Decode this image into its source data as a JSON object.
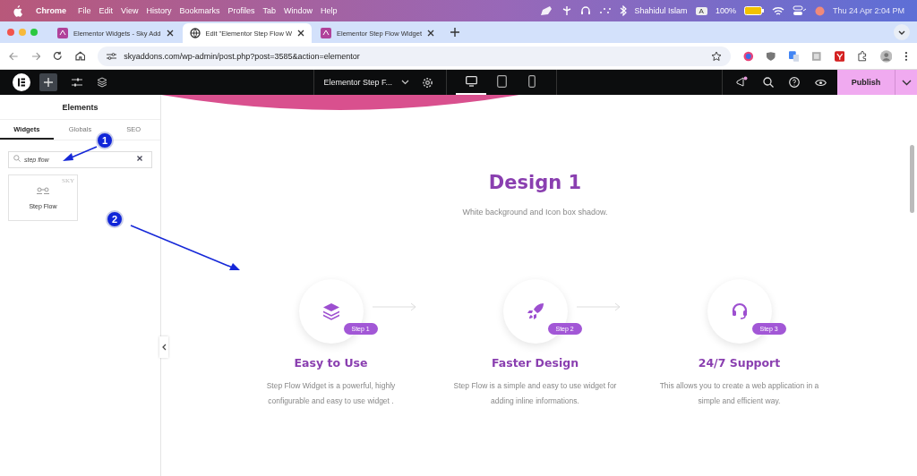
{
  "menubar": {
    "app": "Chrome",
    "items": [
      "File",
      "Edit",
      "View",
      "History",
      "Bookmarks",
      "Profiles",
      "Tab",
      "Window",
      "Help"
    ],
    "user": "Shahidul Islam",
    "input_source": "A",
    "battery": "100%",
    "datetime": "Thu 24 Apr  2:04 PM"
  },
  "browser_tabs": [
    {
      "title": "Elementor Widgets - Sky Add",
      "selected": false,
      "kind": "site"
    },
    {
      "title": "Edit \"Elementor Step Flow W",
      "selected": true,
      "kind": "globe"
    },
    {
      "title": "Elementor Step Flow Widget",
      "selected": false,
      "kind": "site"
    }
  ],
  "address_bar": {
    "url": "skyaddons.com/wp-admin/post.php?post=3585&action=elementor"
  },
  "editor_bar": {
    "document_title": "Elementor Step F...",
    "devices": [
      {
        "kind": "desktop",
        "selected": true
      },
      {
        "kind": "tablet",
        "selected": false
      },
      {
        "kind": "mobile",
        "selected": false
      }
    ],
    "publish": "Publish"
  },
  "panel": {
    "title": "Elements",
    "tabs": [
      {
        "label": "Widgets",
        "selected": true
      },
      {
        "label": "Globals",
        "selected": false
      },
      {
        "label": "SEO",
        "selected": false
      }
    ],
    "search": {
      "value": "step flow"
    },
    "widget": {
      "label": "Step Flow",
      "badge": "SKY"
    }
  },
  "canvas": {
    "heading": "Design 1",
    "subtitle": "White background and Icon box shadow.",
    "steps": [
      {
        "kind": "layers",
        "badge": "Step 1",
        "title": "Easy to Use",
        "description": "Step Flow Widget is a powerful, highly configurable and easy to use widget ."
      },
      {
        "kind": "rocket",
        "badge": "Step 2",
        "title": "Faster Design",
        "description": "Step Flow is a simple and easy to use widget for adding inline informations."
      },
      {
        "kind": "headset",
        "badge": "Step 3",
        "title": "24/7 Support",
        "description": "This allows you to create a web application in a simple and efficient way."
      }
    ]
  },
  "annotations": [
    "1",
    "2"
  ]
}
